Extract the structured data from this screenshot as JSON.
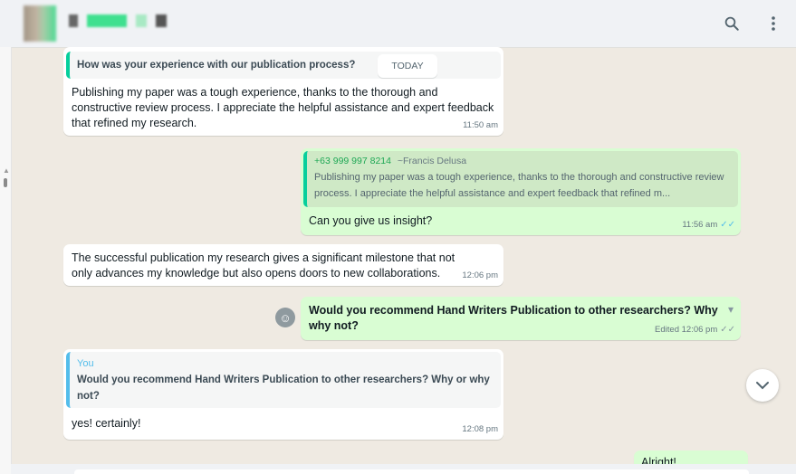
{
  "header": {
    "contact_name": "",
    "icons": [
      "search-icon",
      "menu-kebab-icon"
    ]
  },
  "chat": {
    "date_divider": "TODAY",
    "messages": [
      {
        "direction": "in",
        "quote_text": "How was your experience with our publication process?",
        "text": "Publishing my paper was a tough experience, thanks to the thorough and constructive review process. I appreciate the helpful assistance and expert feedback that refined my research.",
        "time": "11:50 am"
      },
      {
        "direction": "out",
        "quote_author": "+63 999 997 8214",
        "quote_author_alt": "~Francis Delusa",
        "quote_text": "Publishing my paper was a tough experience, thanks to the thorough and constructive review process. I appreciate the helpful assistance and expert feedback that refined m...",
        "text": "Can you give us insight?",
        "time": "11:56 am"
      },
      {
        "direction": "in",
        "text": "The successful publication my research gives a significant milestone that not only advances my knowledge but also opens doors to new collaborations.",
        "time": "12:06 pm"
      },
      {
        "direction": "out",
        "text": "Would you recommend Hand Writers Publication to other researchers? Why why not?",
        "time": "Edited 12:06 pm"
      },
      {
        "direction": "in",
        "quote_author": "You",
        "quote_text": "Would you recommend Hand Writers Publication to other researchers? Why or why not?",
        "text": "yes! certainly!",
        "time": "12:08 pm"
      },
      {
        "direction": "out",
        "text": "Alright!"
      }
    ]
  },
  "colors": {
    "chat_background": "#efeae2",
    "incoming_bubble": "#ffffff",
    "outgoing_bubble": "#d9fdd3",
    "accent": "#06cf9c",
    "read_ticks": "#53bdeb"
  }
}
